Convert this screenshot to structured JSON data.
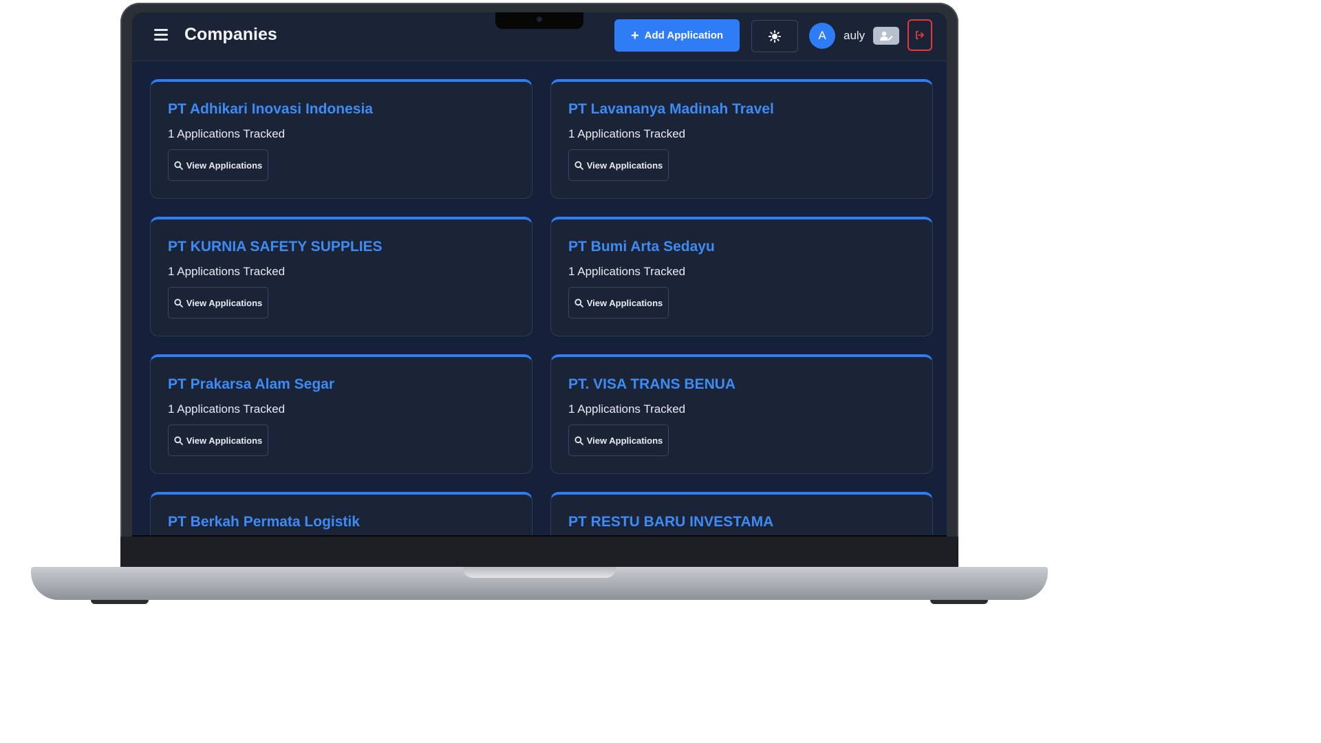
{
  "header": {
    "title": "Companies",
    "add_label": "Add Application",
    "avatar_initial": "A",
    "username": "auly"
  },
  "companies": [
    {
      "name": "PT Adhikari Inovasi Indonesia",
      "count_text": "1 Applications Tracked",
      "button": "View Applications"
    },
    {
      "name": "PT Lavananya Madinah Travel",
      "count_text": "1 Applications Tracked",
      "button": "View Applications"
    },
    {
      "name": "PT KURNIA SAFETY SUPPLIES",
      "count_text": "1 Applications Tracked",
      "button": "View Applications"
    },
    {
      "name": "PT Bumi Arta Sedayu",
      "count_text": "1 Applications Tracked",
      "button": "View Applications"
    },
    {
      "name": "PT Prakarsa Alam Segar",
      "count_text": "1 Applications Tracked",
      "button": "View Applications"
    },
    {
      "name": "PT. VISA TRANS BENUA",
      "count_text": "1 Applications Tracked",
      "button": "View Applications"
    },
    {
      "name": "PT Berkah Permata Logistik"
    },
    {
      "name": "PT RESTU BARU INVESTAMA"
    }
  ],
  "colors": {
    "accent": "#2f7df6",
    "background": "#15203a",
    "card": "#1b2337",
    "company_name": "#3d8bf5",
    "logout_border": "#e53a3a"
  },
  "icons": {
    "menu": "hamburger-menu-icon",
    "add": "plus-icon",
    "theme": "sun-icon",
    "profile": "user-edit-icon",
    "logout": "logout-icon",
    "view": "search-icon"
  }
}
